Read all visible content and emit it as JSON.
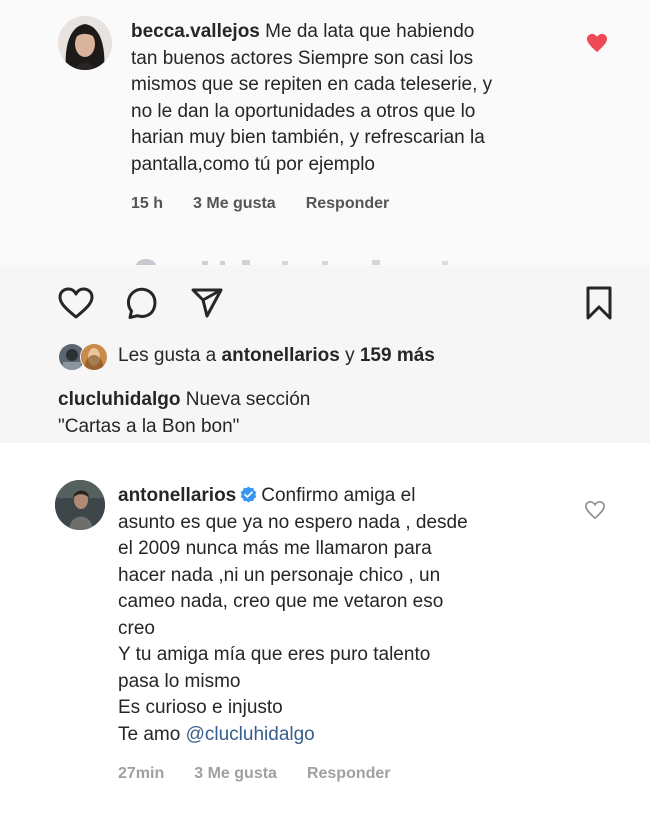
{
  "comment1": {
    "username": "becca.vallejos",
    "lines": [
      "Me da lata que habiendo",
      "tan buenos actores Siempre son casi los",
      "mismos que se repiten en cada teleserie, y",
      "no le dan la oportunidades a otros que lo",
      "harian muy bien también, y refrescarian la",
      "pantalla,como tú por ejemplo"
    ],
    "time": "15 h",
    "likes": "3 Me gusta",
    "reply": "Responder",
    "liked_color": "#ed4956"
  },
  "post": {
    "likes_prefix": "Les gusta a",
    "likes_user": "antonellarios",
    "likes_and": "y",
    "likes_count": "159 más",
    "caption_user": "clucluhidalgo",
    "caption_line1": "Nueva sección",
    "caption_line2": "\"Cartas a la Bon bon\"",
    "icons": [
      "heart-icon",
      "comment-icon",
      "share-icon",
      "bookmark-icon"
    ]
  },
  "comment2": {
    "username": "antonellarios",
    "lines": [
      "Confirmo amiga el",
      "asunto es que ya no espero nada , desde",
      "el 2009 nunca más me llamaron para",
      "hacer nada ,ni un personaje chico , un",
      "cameo nada, creo que me vetaron eso",
      "creo",
      "Y tu amiga mía que eres puro talento",
      "pasa lo mismo",
      "Es curioso e injusto",
      "Te amo"
    ],
    "mention": "@clucluhidalgo",
    "time": "27min",
    "likes": "3 Me gusta",
    "reply": "Responder",
    "verified_color": "#3897f0",
    "mention_color": "#375e8c"
  }
}
